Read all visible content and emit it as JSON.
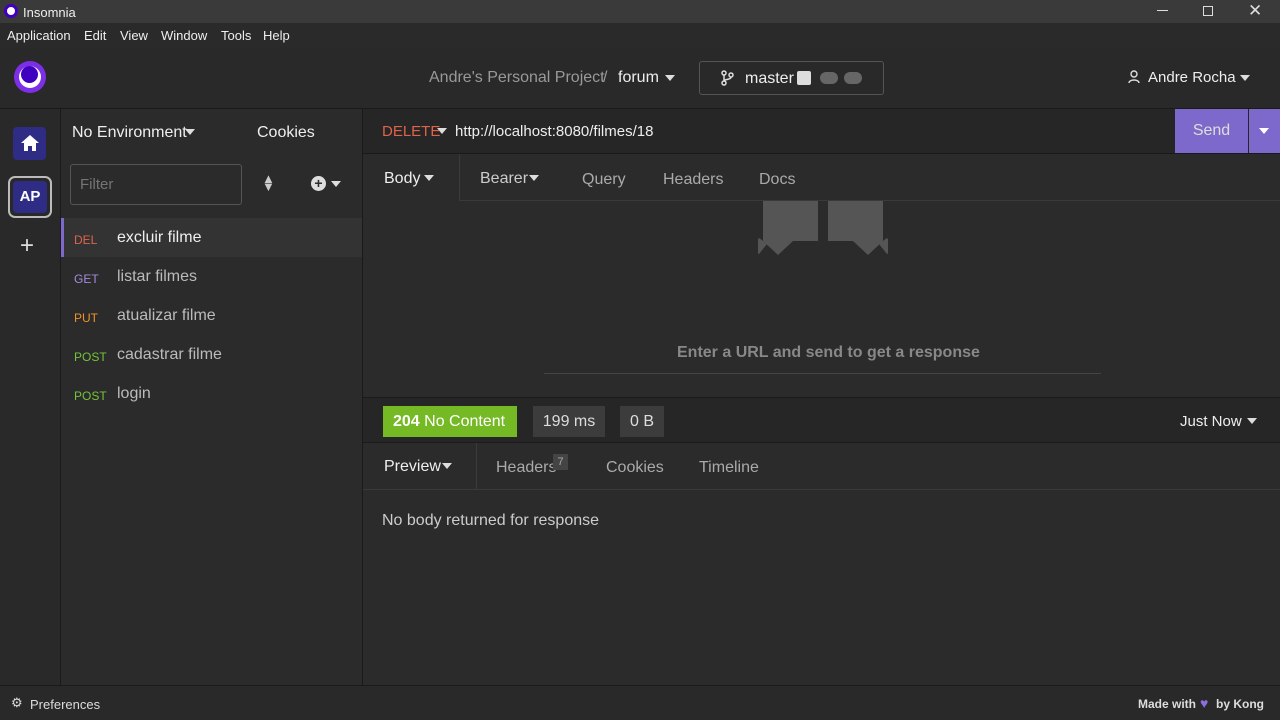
{
  "window": {
    "title": "Insomnia"
  },
  "menu": [
    "Application",
    "Edit",
    "View",
    "Window",
    "Tools",
    "Help"
  ],
  "header": {
    "project": "Andre's Personal Project",
    "separator": "/",
    "collection": "forum",
    "branch": "master",
    "user": "Andre Rocha"
  },
  "rail": {
    "workspace_initials": "AP"
  },
  "sidebar": {
    "environment": "No Environment",
    "cookies": "Cookies",
    "filter_placeholder": "Filter",
    "requests": [
      {
        "method": "DEL",
        "name": "excluir filme",
        "color": "#e0634a",
        "active": true
      },
      {
        "method": "GET",
        "name": "listar filmes",
        "color": "#a58ad9"
      },
      {
        "method": "PUT",
        "name": "atualizar filme",
        "color": "#f0922b"
      },
      {
        "method": "POST",
        "name": "cadastrar filme",
        "color": "#74c43a"
      },
      {
        "method": "POST",
        "name": "login",
        "color": "#74c43a"
      }
    ]
  },
  "request": {
    "method": "DELETE",
    "url": "http://localhost:8080/filmes/18",
    "send": "Send",
    "tabs": {
      "body": "Body",
      "auth": "Bearer",
      "query": "Query",
      "headers": "Headers",
      "docs": "Docs"
    },
    "empty_hint": "Enter a URL and send to get a response"
  },
  "response": {
    "status_code": "204",
    "status_text": "No Content",
    "time": "199 ms",
    "size": "0 B",
    "when": "Just Now",
    "tabs": {
      "preview": "Preview",
      "headers": "Headers",
      "headers_count": "7",
      "cookies": "Cookies",
      "timeline": "Timeline"
    },
    "body_message": "No body returned for response"
  },
  "footer": {
    "preferences": "Preferences",
    "made_with": "Made with",
    "by": "by Kong"
  },
  "colors": {
    "accent": "#7d69cb",
    "success": "#75ba24",
    "delete": "#e0634a"
  }
}
